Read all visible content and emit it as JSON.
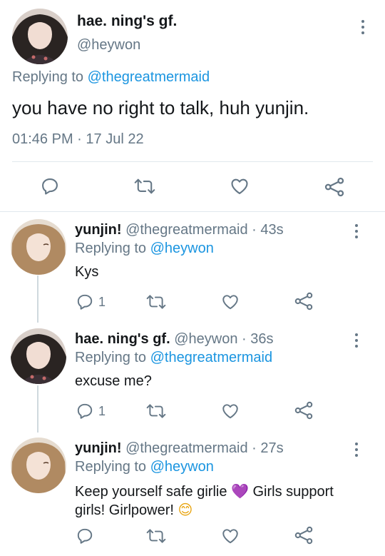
{
  "main_tweet": {
    "display_name": "hae. ning's gf.",
    "handle": "@heywon",
    "replying_prefix": "Replying to ",
    "replying_to": "@thegreatmermaid",
    "text": "you have no right to talk, huh yunjin.",
    "time": "01:46 PM",
    "separator": " · ",
    "date": "17 Jul 22"
  },
  "replies": [
    {
      "display_name": "yunjin!",
      "handle_time": "@thegreatmermaid · 43s",
      "replying_prefix": "Replying to ",
      "replying_to": "@heywon",
      "text": "Kys",
      "reply_count": "1"
    },
    {
      "display_name": "hae. ning's gf.",
      "handle_time": "@heywon · 36s",
      "replying_prefix": "Replying to ",
      "replying_to": "@thegreatmermaid",
      "text": "excuse me?",
      "reply_count": "1"
    },
    {
      "display_name": "yunjin!",
      "handle_time": "@thegreatmermaid · 27s",
      "replying_prefix": "Replying to ",
      "replying_to": "@heywon",
      "text_line1": "Keep yourself safe girlie ",
      "heart_emoji": "💜",
      "text_line1b": " Girls support",
      "text_line2": "girls! Girlpower! ",
      "smile_emoji": "😊",
      "reply_count": ""
    }
  ],
  "colors": {
    "link": "#1b95e0",
    "muted": "#657786",
    "text": "#14171a",
    "divider": "#e1e8ed"
  },
  "icons": [
    "reply-icon",
    "retweet-icon",
    "like-icon",
    "share-icon",
    "more-icon"
  ]
}
